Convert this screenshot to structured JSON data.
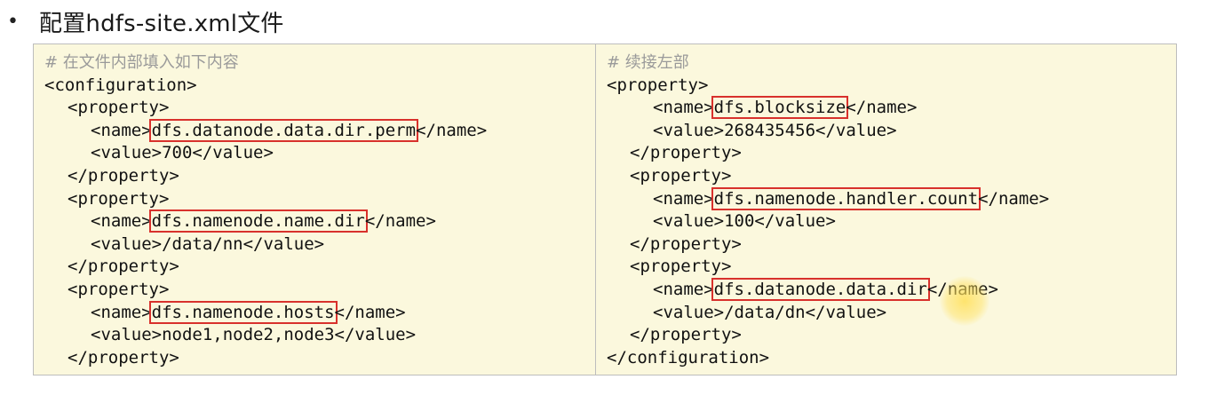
{
  "heading": {
    "bullet": "•",
    "title": "配置hdfs-site.xml文件"
  },
  "left": {
    "comment": "# 在文件内部填入如下内容",
    "lines": [
      "<configuration>",
      "<property>",
      "<name>",
      "dfs.datanode.data.dir.perm",
      "</name>",
      "<value>700</value>",
      "</property>",
      "<property>",
      "<name>",
      "dfs.namenode.name.dir",
      "</name>",
      "<value>/data/nn</value>",
      "</property>",
      "<property>",
      "<name>",
      "dfs.namenode.hosts",
      "</name>",
      "<value>node1,node2,node3</value>",
      "</property>"
    ]
  },
  "right": {
    "comment": "# 续接左部",
    "lines": [
      "<property>",
      "<name>",
      "dfs.blocksize",
      "</name>",
      "<value>268435456</value>",
      "</property>",
      "<property>",
      "<name>",
      "dfs.namenode.handler.count",
      "</name>",
      "<value>100</value>",
      "</property>",
      "<property>",
      "<name>",
      "dfs.datanode.data.dir",
      "</name>",
      "<value>/data/dn</value>",
      "</property>",
      "</configuration>"
    ]
  },
  "colors": {
    "panel_bg": "#fbf8dd",
    "highlight_border": "#d8312c",
    "comment": "#9a9a9a",
    "cursor_glow": "#ffe05a"
  }
}
